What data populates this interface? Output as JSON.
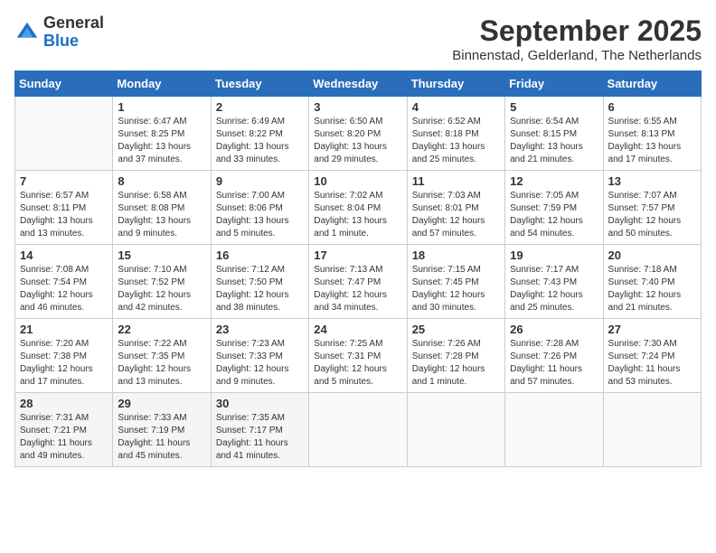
{
  "logo": {
    "text_general": "General",
    "text_blue": "Blue"
  },
  "header": {
    "month": "September 2025",
    "location": "Binnenstad, Gelderland, The Netherlands"
  },
  "weekdays": [
    "Sunday",
    "Monday",
    "Tuesday",
    "Wednesday",
    "Thursday",
    "Friday",
    "Saturday"
  ],
  "weeks": [
    [
      {
        "day": "",
        "info": ""
      },
      {
        "day": "1",
        "info": "Sunrise: 6:47 AM\nSunset: 8:25 PM\nDaylight: 13 hours\nand 37 minutes."
      },
      {
        "day": "2",
        "info": "Sunrise: 6:49 AM\nSunset: 8:22 PM\nDaylight: 13 hours\nand 33 minutes."
      },
      {
        "day": "3",
        "info": "Sunrise: 6:50 AM\nSunset: 8:20 PM\nDaylight: 13 hours\nand 29 minutes."
      },
      {
        "day": "4",
        "info": "Sunrise: 6:52 AM\nSunset: 8:18 PM\nDaylight: 13 hours\nand 25 minutes."
      },
      {
        "day": "5",
        "info": "Sunrise: 6:54 AM\nSunset: 8:15 PM\nDaylight: 13 hours\nand 21 minutes."
      },
      {
        "day": "6",
        "info": "Sunrise: 6:55 AM\nSunset: 8:13 PM\nDaylight: 13 hours\nand 17 minutes."
      }
    ],
    [
      {
        "day": "7",
        "info": "Sunrise: 6:57 AM\nSunset: 8:11 PM\nDaylight: 13 hours\nand 13 minutes."
      },
      {
        "day": "8",
        "info": "Sunrise: 6:58 AM\nSunset: 8:08 PM\nDaylight: 13 hours\nand 9 minutes."
      },
      {
        "day": "9",
        "info": "Sunrise: 7:00 AM\nSunset: 8:06 PM\nDaylight: 13 hours\nand 5 minutes."
      },
      {
        "day": "10",
        "info": "Sunrise: 7:02 AM\nSunset: 8:04 PM\nDaylight: 13 hours\nand 1 minute."
      },
      {
        "day": "11",
        "info": "Sunrise: 7:03 AM\nSunset: 8:01 PM\nDaylight: 12 hours\nand 57 minutes."
      },
      {
        "day": "12",
        "info": "Sunrise: 7:05 AM\nSunset: 7:59 PM\nDaylight: 12 hours\nand 54 minutes."
      },
      {
        "day": "13",
        "info": "Sunrise: 7:07 AM\nSunset: 7:57 PM\nDaylight: 12 hours\nand 50 minutes."
      }
    ],
    [
      {
        "day": "14",
        "info": "Sunrise: 7:08 AM\nSunset: 7:54 PM\nDaylight: 12 hours\nand 46 minutes."
      },
      {
        "day": "15",
        "info": "Sunrise: 7:10 AM\nSunset: 7:52 PM\nDaylight: 12 hours\nand 42 minutes."
      },
      {
        "day": "16",
        "info": "Sunrise: 7:12 AM\nSunset: 7:50 PM\nDaylight: 12 hours\nand 38 minutes."
      },
      {
        "day": "17",
        "info": "Sunrise: 7:13 AM\nSunset: 7:47 PM\nDaylight: 12 hours\nand 34 minutes."
      },
      {
        "day": "18",
        "info": "Sunrise: 7:15 AM\nSunset: 7:45 PM\nDaylight: 12 hours\nand 30 minutes."
      },
      {
        "day": "19",
        "info": "Sunrise: 7:17 AM\nSunset: 7:43 PM\nDaylight: 12 hours\nand 25 minutes."
      },
      {
        "day": "20",
        "info": "Sunrise: 7:18 AM\nSunset: 7:40 PM\nDaylight: 12 hours\nand 21 minutes."
      }
    ],
    [
      {
        "day": "21",
        "info": "Sunrise: 7:20 AM\nSunset: 7:38 PM\nDaylight: 12 hours\nand 17 minutes."
      },
      {
        "day": "22",
        "info": "Sunrise: 7:22 AM\nSunset: 7:35 PM\nDaylight: 12 hours\nand 13 minutes."
      },
      {
        "day": "23",
        "info": "Sunrise: 7:23 AM\nSunset: 7:33 PM\nDaylight: 12 hours\nand 9 minutes."
      },
      {
        "day": "24",
        "info": "Sunrise: 7:25 AM\nSunset: 7:31 PM\nDaylight: 12 hours\nand 5 minutes."
      },
      {
        "day": "25",
        "info": "Sunrise: 7:26 AM\nSunset: 7:28 PM\nDaylight: 12 hours\nand 1 minute."
      },
      {
        "day": "26",
        "info": "Sunrise: 7:28 AM\nSunset: 7:26 PM\nDaylight: 11 hours\nand 57 minutes."
      },
      {
        "day": "27",
        "info": "Sunrise: 7:30 AM\nSunset: 7:24 PM\nDaylight: 11 hours\nand 53 minutes."
      }
    ],
    [
      {
        "day": "28",
        "info": "Sunrise: 7:31 AM\nSunset: 7:21 PM\nDaylight: 11 hours\nand 49 minutes."
      },
      {
        "day": "29",
        "info": "Sunrise: 7:33 AM\nSunset: 7:19 PM\nDaylight: 11 hours\nand 45 minutes."
      },
      {
        "day": "30",
        "info": "Sunrise: 7:35 AM\nSunset: 7:17 PM\nDaylight: 11 hours\nand 41 minutes."
      },
      {
        "day": "",
        "info": ""
      },
      {
        "day": "",
        "info": ""
      },
      {
        "day": "",
        "info": ""
      },
      {
        "day": "",
        "info": ""
      }
    ]
  ]
}
